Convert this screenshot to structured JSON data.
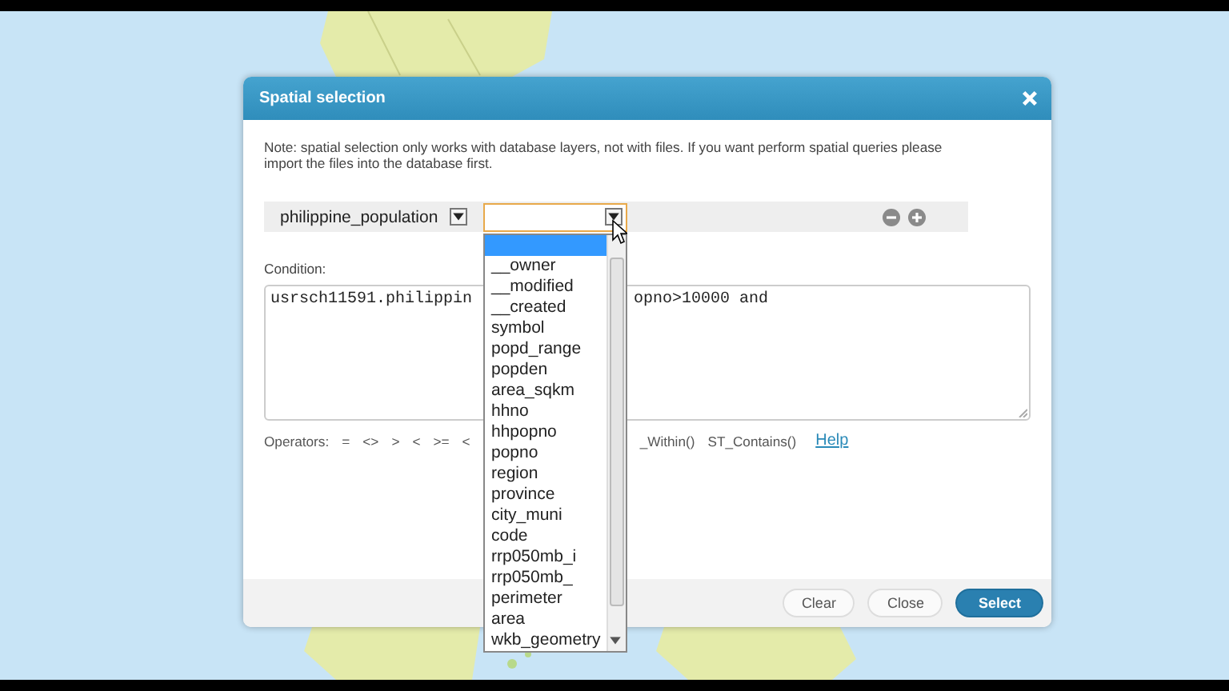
{
  "dialog": {
    "title": "Spatial selection",
    "note": "Note: spatial selection only works with database layers, not with files. If you want perform spatial queries please import the files into the database first.",
    "layer_select": {
      "value": "philippine_population"
    },
    "condition_label": "Condition:",
    "condition_parts": [
      "usrsch11591.philippin",
      "opno>10000 and"
    ],
    "operators_label": "Operators:",
    "operators": [
      "=",
      "<>",
      ">",
      "<",
      ">=",
      "<"
    ],
    "functions": [
      "_Within()",
      "ST_Contains()"
    ],
    "help_link": "Help",
    "buttons": [
      {
        "label": "Clear",
        "kind": "plain"
      },
      {
        "label": "Close",
        "kind": "plain"
      },
      {
        "label": "Select",
        "kind": "primary"
      }
    ]
  },
  "field_dropdown": {
    "expanded": true,
    "options": [
      {
        "selected": true
      },
      {
        "label": "__owner",
        "selected": false
      },
      {
        "label": "__modified",
        "selected": false
      },
      {
        "label": "__created",
        "selected": false
      },
      {
        "label": "symbol",
        "selected": false
      },
      {
        "label": "popd_range",
        "selected": false
      },
      {
        "label": "popden",
        "selected": false
      },
      {
        "label": "area_sqkm",
        "selected": false
      },
      {
        "label": "hhno",
        "selected": false
      },
      {
        "label": "hhpopno",
        "selected": false
      },
      {
        "label": "popno",
        "selected": false
      },
      {
        "label": "region",
        "selected": false
      },
      {
        "label": "province",
        "selected": false
      },
      {
        "label": "city_muni",
        "selected": false
      },
      {
        "label": "code",
        "selected": false
      },
      {
        "label": "rrp050mb_i",
        "selected": false
      },
      {
        "label": "rrp050mb_",
        "selected": false
      },
      {
        "label": "perimeter",
        "selected": false
      },
      {
        "label": "area",
        "selected": false
      },
      {
        "label": "wkb_geometry",
        "selected": false
      }
    ]
  }
}
